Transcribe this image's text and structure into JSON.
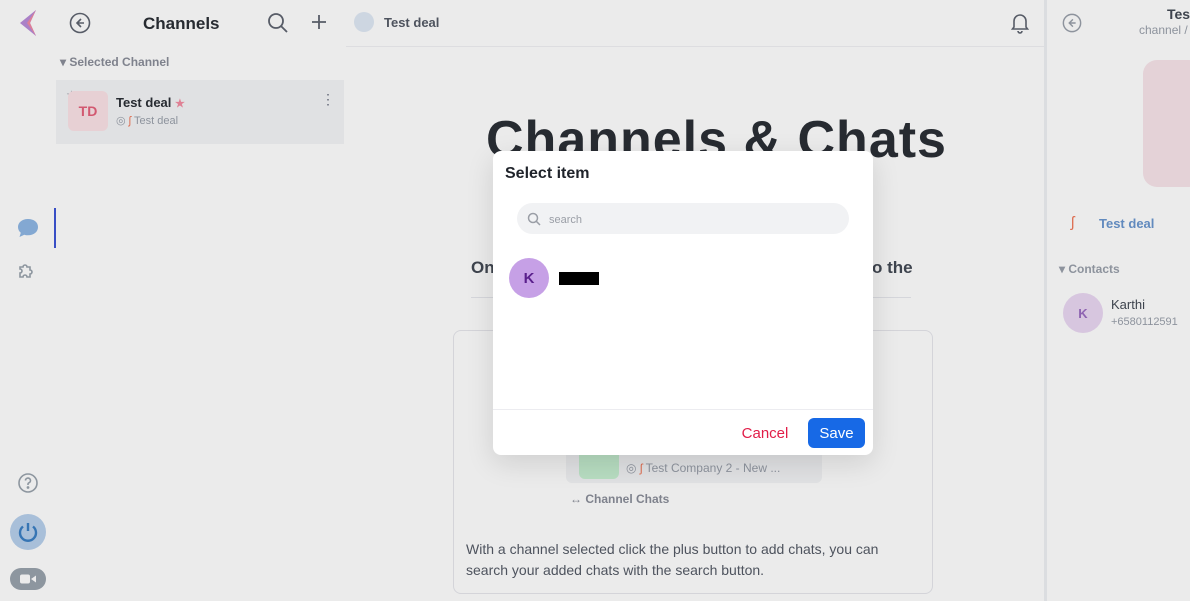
{
  "app": {
    "brand_color": "#e4607a",
    "accent_color": "#1769e6",
    "danger_color": "#e11d48"
  },
  "rail": {
    "icons": [
      "logo-icon",
      "chat-bubble-icon",
      "puzzle-icon",
      "help-icon",
      "status-icon",
      "video-icon"
    ]
  },
  "channels_panel": {
    "title": "Channels",
    "section_label": "Selected Channel",
    "channel": {
      "initials": "TD",
      "name": "Test deal",
      "subtitle": "Test deal"
    }
  },
  "main": {
    "header_title": "Test deal",
    "heading": "Channels & Chats",
    "description_start": "On",
    "description_end": "o the",
    "card": {
      "item_subtitle": "Test Company 2 - New ...",
      "section_label": "Channel Chats",
      "help_text": "With a channel selected click the plus button to add chats, you can search your added chats with the search button."
    }
  },
  "details": {
    "header_title": "Tes",
    "header_subtitle": "channel /",
    "deal_label": "Test deal",
    "contacts_label": "Contacts",
    "contact": {
      "initial": "K",
      "name": "Karthi",
      "phone": "+6580112591"
    }
  },
  "modal": {
    "title": "Select item",
    "search_placeholder": "search",
    "items": [
      {
        "initial": "K"
      }
    ],
    "cancel_label": "Cancel",
    "save_label": "Save"
  }
}
